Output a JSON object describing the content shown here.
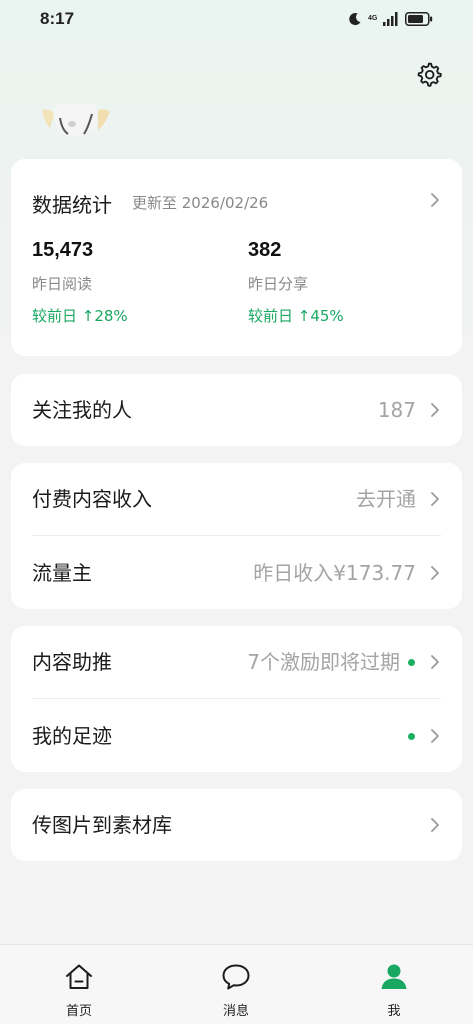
{
  "status_bar": {
    "time": "8:17",
    "network": "4G"
  },
  "stats_card": {
    "title": "数据统计",
    "updated": "更新至 2026/02/26",
    "items": [
      {
        "value": "15,473",
        "label": "昨日阅读",
        "change": "较前日 ↑28%"
      },
      {
        "value": "382",
        "label": "昨日分享",
        "change": "较前日 ↑45%"
      }
    ]
  },
  "followers": {
    "label": "关注我的人",
    "value": "187"
  },
  "income": {
    "paid_content": {
      "label": "付费内容收入",
      "value": "去开通"
    },
    "traffic": {
      "label": "流量主",
      "value": "昨日收入¥173.77"
    }
  },
  "promotion": {
    "boost": {
      "label": "内容助推",
      "value": "7个激励即将过期"
    },
    "footprint": {
      "label": "我的足迹"
    }
  },
  "upload": {
    "label": "传图片到素材库"
  },
  "tabbar": {
    "tabs": [
      {
        "label": "首页",
        "icon": "home-icon",
        "active": false
      },
      {
        "label": "消息",
        "icon": "message-icon",
        "active": false
      },
      {
        "label": "我",
        "icon": "person-icon",
        "active": true
      }
    ]
  },
  "colors": {
    "accent": "#19a861",
    "dot": "#19b15f",
    "muted": "#a4a4a4",
    "background": "#f2f3f2"
  }
}
